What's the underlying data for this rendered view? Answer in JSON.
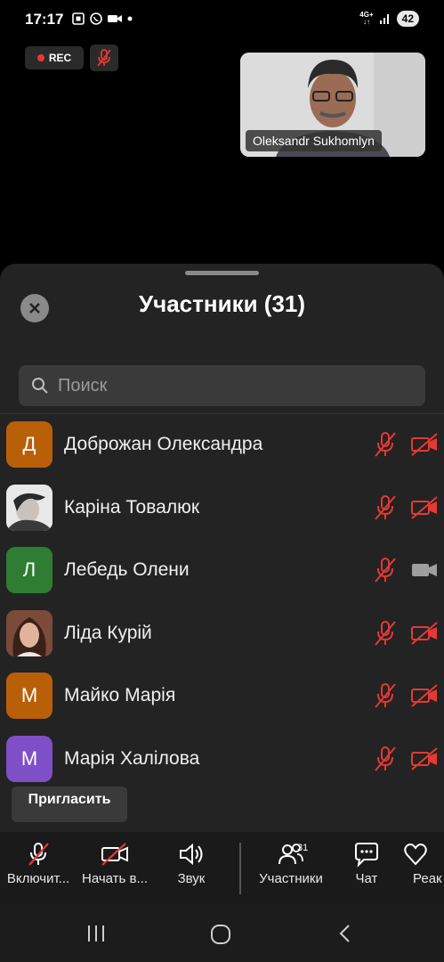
{
  "status": {
    "time": "17:17",
    "network": "4G+",
    "battery": "42"
  },
  "recording": {
    "label": "REC"
  },
  "video": {
    "name": "Oleksandr Sukhomlyn"
  },
  "panel": {
    "title": "Участники (31)",
    "search_placeholder": "Поиск",
    "participants": [
      {
        "initial": "Д",
        "name": "Доброжан Олександра",
        "avatar_color": "#b95f08",
        "mic": "muted",
        "video": "off"
      },
      {
        "initial": "",
        "name": "Каріна Товалюк",
        "avatar_color": "#d9d9d9",
        "mic": "muted",
        "video": "off"
      },
      {
        "initial": "Л",
        "name": "Лебедь Олени",
        "avatar_color": "#2e7d32",
        "mic": "muted",
        "video": "on"
      },
      {
        "initial": "",
        "name": "Ліда Курій",
        "avatar_color": "#8a5a4a",
        "mic": "muted",
        "video": "off"
      },
      {
        "initial": "М",
        "name": "Майко Марія",
        "avatar_color": "#b95f08",
        "mic": "muted",
        "video": "off"
      },
      {
        "initial": "М",
        "name": "Марія Халілова",
        "avatar_color": "#7e4fc7",
        "mic": "muted",
        "video": "off"
      }
    ],
    "invite_label": "Пригласить"
  },
  "toolbar": {
    "unmute_label": "Включит...",
    "video_label": "Начать в...",
    "audio_label": "Звук",
    "participants_label": "Участники",
    "participants_count": "31",
    "chat_label": "Чат",
    "react_label": "Реак"
  },
  "colors": {
    "muted_red": "#e53935",
    "sheet_bg": "#232323"
  }
}
